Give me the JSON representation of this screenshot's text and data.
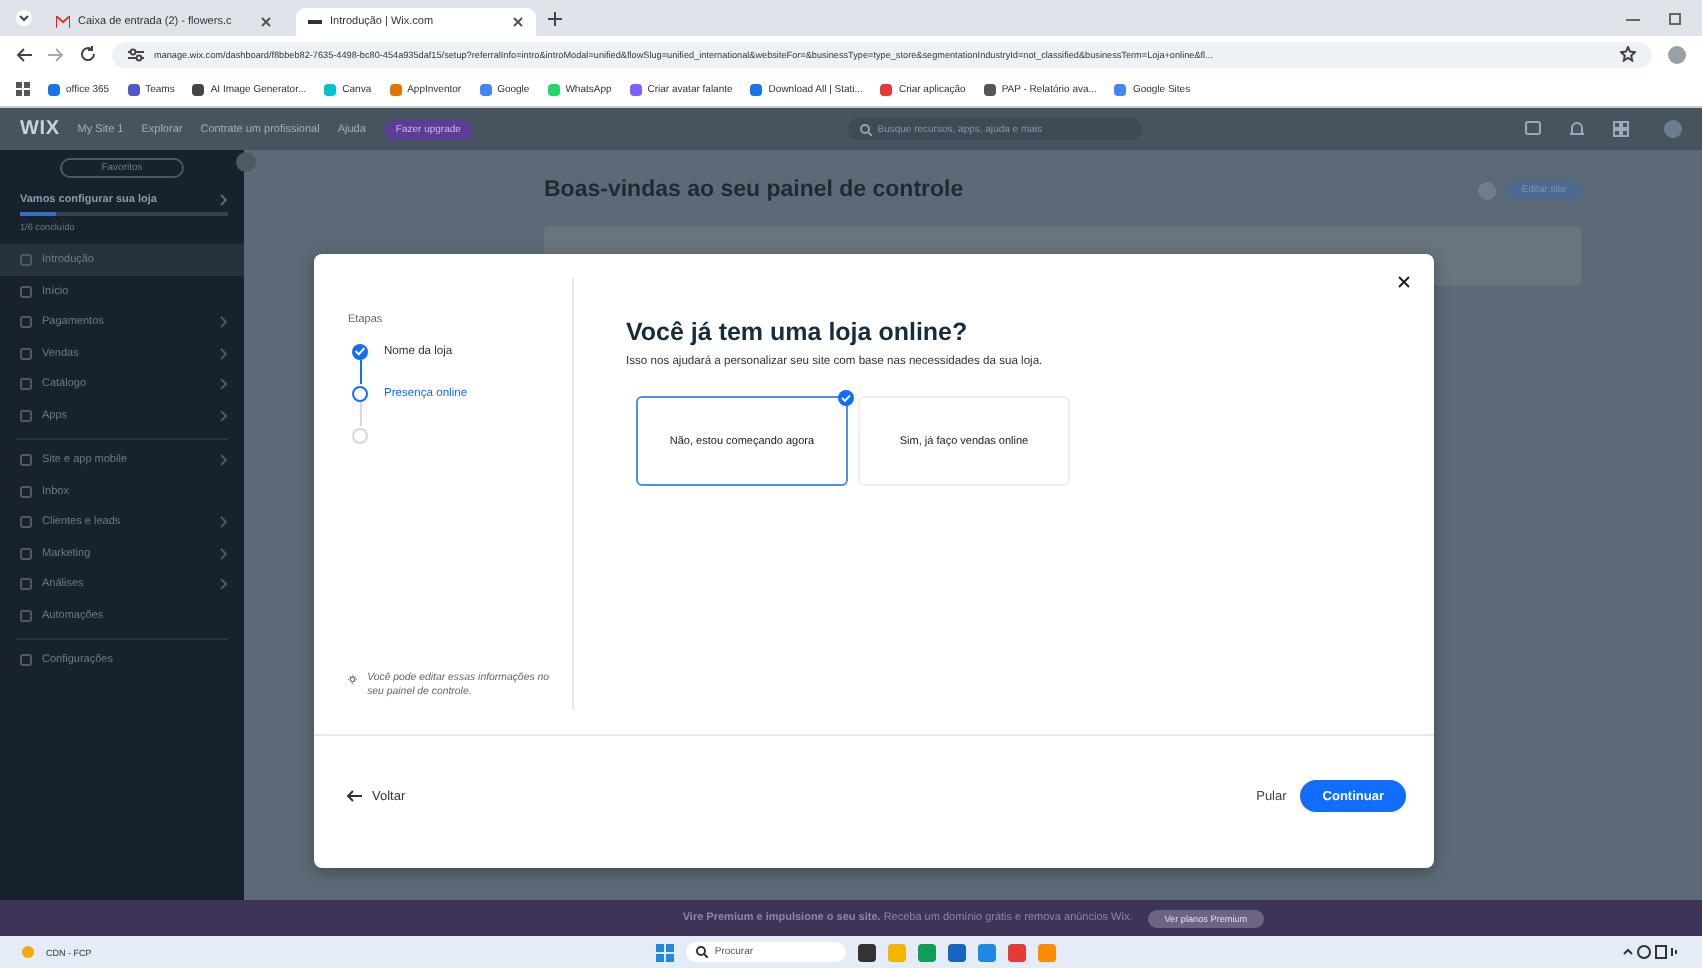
{
  "browser": {
    "tabs": [
      {
        "title": "Caixa de entrada (2) - flowers.c",
        "selected": false
      },
      {
        "title": "Introdução | Wix.com",
        "selected": true
      }
    ],
    "url": "manage.wix.com/dashboard/f8bbeb82-7635-4498-bc80-454a935daf15/setup?referralInfo=intro&introModal=unified&flowSlug=unified_international&websiteFor=&businessType=type_store&segmentationIndustryId=not_classified&businessTerm=Loja+online&fl...",
    "bookmarks": [
      "office 365",
      "Teams",
      "AI Image Generator...",
      "Canva",
      "AppInventor",
      "Google",
      "WhatsApp",
      "Criar avatar falante",
      "Download All | Stati...",
      "Criar aplicação",
      "PAP - Relatório ava...",
      "Google Sites"
    ]
  },
  "topbar": {
    "logo": "WIX",
    "menus": [
      "My Site 1",
      "Explorar",
      "Contrate um profissional",
      "Ajuda"
    ],
    "upgrade": "Fazer upgrade",
    "search": {
      "placeholder": "Busque recursos, apps, ajuda e mais"
    }
  },
  "sidebar": {
    "favorites": "Favoritos",
    "setup_title": "Vamos configurar sua loja",
    "progress": {
      "label": "1/6 concluído",
      "level": 0.17
    },
    "items": [
      {
        "label": "Introdução",
        "selected": true,
        "expandable": false
      },
      {
        "label": "Início",
        "selected": false,
        "expandable": false
      },
      {
        "label": "Pagamentos",
        "selected": false,
        "expandable": true
      },
      {
        "label": "Vendas",
        "selected": false,
        "expandable": true
      },
      {
        "label": "Catálogo",
        "selected": false,
        "expandable": true
      },
      {
        "label": "Apps",
        "selected": false,
        "expandable": true
      },
      {
        "label": "Site e app mobile",
        "selected": false,
        "expandable": true
      },
      {
        "label": "Inbox",
        "selected": false,
        "expandable": false
      },
      {
        "label": "Clientes e leads",
        "selected": false,
        "expandable": true
      },
      {
        "label": "Marketing",
        "selected": false,
        "expandable": true
      },
      {
        "label": "Análises",
        "selected": false,
        "expandable": true
      },
      {
        "label": "Automações",
        "selected": false,
        "expandable": false
      },
      {
        "label": "Configurações",
        "selected": false,
        "expandable": false
      }
    ]
  },
  "page": {
    "title": "Boas-vindas ao seu painel de controle",
    "edit_button": "Editar site"
  },
  "modal": {
    "steps_heading": "Etapas",
    "steps": [
      {
        "label": "Nome da loja",
        "completed": true,
        "selected": false
      },
      {
        "label": "Presença online",
        "completed": false,
        "selected": true
      },
      {
        "completed": false,
        "selected": false
      }
    ],
    "tip": "Você pode editar essas informações no seu painel de controle.",
    "title": "Você já tem uma loja online?",
    "subtitle": "Isso nos ajudará a personalizar seu site com base nas necessidades da sua loja.",
    "options": [
      {
        "label": "Não, estou começando agora",
        "selected": true
      },
      {
        "label": "Sim, já faço vendas online",
        "selected": false
      }
    ],
    "back": "Voltar",
    "skip": "Pular",
    "continue": "Continuar"
  },
  "banner": {
    "text": "**Vire Premium e impulsione o seu site.** Receba um domínio grátis e remova anúncios Wix.",
    "button": "Ver planos Premium"
  },
  "taskbar": {
    "weather": "CDN - FCP",
    "search": {
      "placeholder": "Procurar"
    }
  }
}
